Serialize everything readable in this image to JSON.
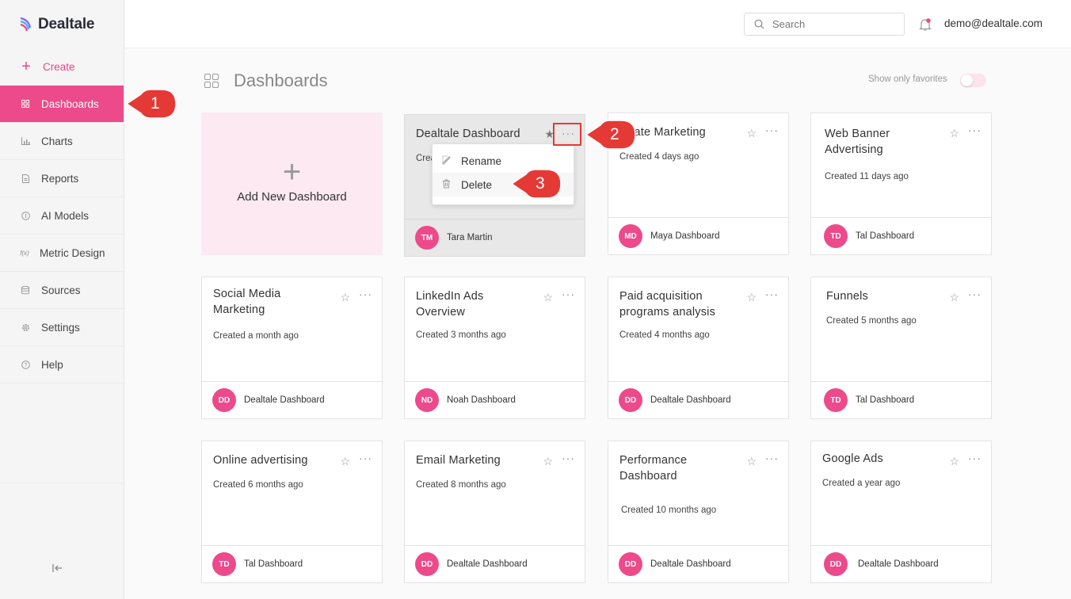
{
  "app": {
    "name": "Dealtale"
  },
  "colors": {
    "accent": "#ec4a8b",
    "callout": "#e53935",
    "sidebar_bg": "#f5f5f5"
  },
  "sidebar": {
    "create_label": "Create",
    "items": [
      {
        "label": "Dashboards",
        "icon": "grid-icon",
        "active": true
      },
      {
        "label": "Charts",
        "icon": "bar-chart-icon"
      },
      {
        "label": "Reports",
        "icon": "document-icon"
      },
      {
        "label": "AI Models",
        "icon": "ai-icon"
      },
      {
        "label": "Metric Design",
        "icon": "function-icon",
        "icon_text": "f(x)"
      },
      {
        "label": "Sources",
        "icon": "database-icon"
      },
      {
        "label": "Settings",
        "icon": "gear-icon"
      },
      {
        "label": "Help",
        "icon": "help-icon"
      }
    ]
  },
  "topbar": {
    "search_placeholder": "Search",
    "user_email": "demo@dealtale.com"
  },
  "page": {
    "title": "Dashboards",
    "favorites_label": "Show only favorites",
    "favorites_on": false
  },
  "add_card": {
    "label": "Add New Dashboard"
  },
  "cards": [
    {
      "title": "Dealtale Dashboard",
      "created": "Crea",
      "owner_initials": "TM",
      "owner": "Tara Martin"
    },
    {
      "title": "ffiliate Marketing",
      "created": "Created 4 days ago",
      "owner_initials": "MD",
      "owner": "Maya Dashboard"
    },
    {
      "title": "Web Banner Advertising",
      "created": "Created 11 days ago",
      "owner_initials": "TD",
      "owner": "Tal Dashboard"
    },
    {
      "title": "Social Media Marketing",
      "created": "Created a month ago",
      "owner_initials": "DD",
      "owner": "Dealtale Dashboard"
    },
    {
      "title": "LinkedIn Ads Overview",
      "created": "Created 3 months ago",
      "owner_initials": "ND",
      "owner": "Noah Dashboard"
    },
    {
      "title": "Paid acquisition programs analysis",
      "created": "Created 4 months ago",
      "owner_initials": "DD",
      "owner": "Dealtale Dashboard"
    },
    {
      "title": "Funnels",
      "created": "Created 5 months ago",
      "owner_initials": "TD",
      "owner": "Tal Dashboard"
    },
    {
      "title": "Online advertising",
      "created": "Created 6 months ago",
      "owner_initials": "TD",
      "owner": "Tal Dashboard"
    },
    {
      "title": "Email Marketing",
      "created": "Created 8 months ago",
      "owner_initials": "DD",
      "owner": "Dealtale Dashboard"
    },
    {
      "title": "Performance Dashboard",
      "created": "Created 10 months ago",
      "owner_initials": "DD",
      "owner": "Dealtale Dashboard"
    },
    {
      "title": "Google Ads",
      "created": "Created a year ago",
      "owner_initials": "DD",
      "owner": "Dealtale Dashboard"
    }
  ],
  "context_menu": {
    "items": [
      {
        "label": "Rename",
        "icon": "edit-icon"
      },
      {
        "label": "Delete",
        "icon": "trash-icon"
      }
    ]
  },
  "callouts": [
    "1",
    "2",
    "3"
  ]
}
